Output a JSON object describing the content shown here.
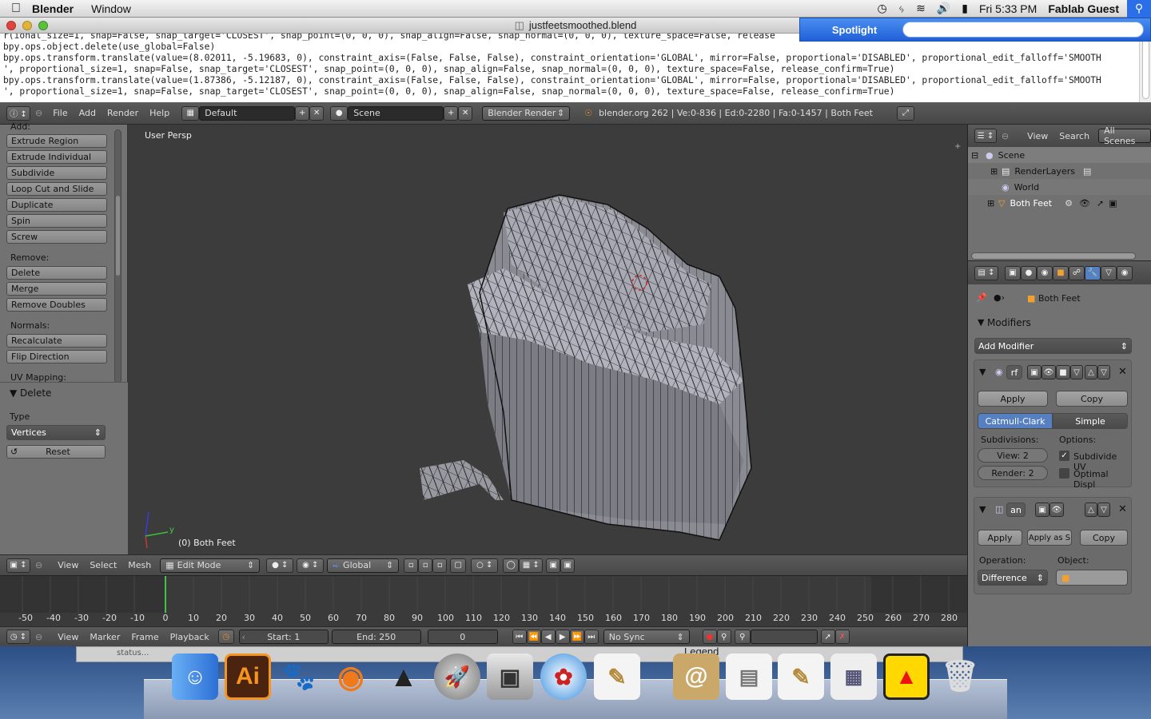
{
  "menubar": {
    "app_name": "Blender",
    "menu_window": "Window",
    "clock": "Fri 5:33 PM",
    "user": "Fablab Guest"
  },
  "window": {
    "title": "justfeetsmoothed.blend"
  },
  "spotlight": {
    "label": "Spotlight",
    "placeholder": ""
  },
  "console": {
    "lines": [
      "r(ional_size=1, snap=False, snap_target='CLOSEST', snap_point=(0, 0, 0), snap_align=False, snap_normal=(0, 0, 0), texture_space=False, release",
      "bpy.ops.object.delete(use_global=False)",
      "bpy.ops.transform.translate(value=(8.02011, -5.19683, 0), constraint_axis=(False, False, False), constraint_orientation='GLOBAL', mirror=False, proportional='DISABLED', proportional_edit_falloff='SMOOTH",
      "', proportional_size=1, snap=False, snap_target='CLOSEST', snap_point=(0, 0, 0), snap_align=False, snap_normal=(0, 0, 0), texture_space=False, release_confirm=True)",
      "bpy.ops.transform.translate(value=(1.87386, -5.12187, 0), constraint_axis=(False, False, False), constraint_orientation='GLOBAL', mirror=False, proportional='DISABLED', proportional_edit_falloff='SMOOTH",
      "', proportional_size=1, snap=False, snap_target='CLOSEST', snap_point=(0, 0, 0), snap_align=False, snap_normal=(0, 0, 0), texture_space=False, release_confirm=True)"
    ]
  },
  "info_header": {
    "menus": [
      "File",
      "Add",
      "Render",
      "Help"
    ],
    "layout": "Default",
    "scene": "Scene",
    "engine": "Blender Render",
    "stats": "blender.org 262 | Ve:0-836 | Ed:0-2280 | Fa:0-1457 | Both Feet"
  },
  "toolshelf": {
    "cut_label": "Add:",
    "add_buttons": [
      "Extrude Region",
      "Extrude Individual",
      "Subdivide",
      "Loop Cut and Slide",
      "Duplicate",
      "Spin",
      "Screw"
    ],
    "remove_label": "Remove:",
    "remove_buttons": [
      "Delete",
      "Merge",
      "Remove Doubles"
    ],
    "normals_label": "Normals:",
    "normals_buttons": [
      "Recalculate",
      "Flip Direction"
    ],
    "uv_label": "UV Mapping:",
    "op_panel_title": "Delete",
    "type_label": "Type",
    "type_value": "Vertices",
    "reset_label": "Reset"
  },
  "viewport": {
    "view_name": "User Persp",
    "object_label": "(0) Both Feet",
    "axis_y": "y"
  },
  "view3d_header": {
    "menus": [
      "View",
      "Select",
      "Mesh"
    ],
    "mode": "Edit Mode",
    "orientation": "Global"
  },
  "timeline": {
    "ticks": [
      "-50",
      "-40",
      "-30",
      "-20",
      "-10",
      "0",
      "10",
      "20",
      "30",
      "40",
      "50",
      "60",
      "70",
      "80",
      "90",
      "100",
      "110",
      "120",
      "130",
      "140",
      "150",
      "160",
      "170",
      "180",
      "190",
      "200",
      "210",
      "220",
      "230",
      "240",
      "250",
      "260",
      "270",
      "280"
    ],
    "menus": [
      "View",
      "Marker",
      "Frame",
      "Playback"
    ],
    "start": "Start: 1",
    "end": "End: 250",
    "current": "0",
    "sync": "No Sync"
  },
  "outliner": {
    "menus": [
      "View",
      "Search"
    ],
    "filter": "All Scenes",
    "items": [
      "Scene",
      "RenderLayers",
      "World",
      "Both Feet"
    ]
  },
  "properties": {
    "object_name": "Both Feet",
    "panel_title": "Modifiers",
    "add_modifier": "Add Modifier",
    "mod1": {
      "name": "rf",
      "apply": "Apply",
      "copy": "Copy",
      "opt_a": "Catmull-Clark",
      "opt_b": "Simple",
      "subdiv_label": "Subdivisions:",
      "options_label": "Options:",
      "view": "View: 2",
      "render": "Render: 2",
      "subdivide_uv": "Subdivide UV",
      "optimal": "Optimal Displ"
    },
    "mod2": {
      "name": "an",
      "apply": "Apply",
      "apply_as": "Apply as S",
      "copy": "Copy",
      "operation_label": "Operation:",
      "object_label": "Object:",
      "operation": "Difference"
    }
  },
  "dock": {
    "ai_label": "Ai",
    "status_text": "status...",
    "legend_text": "Legend"
  },
  "colors": {
    "selected_blue": "#5680c2",
    "spotlight_blue": "#2a6ee8",
    "timeline_marker": "#45c245"
  }
}
